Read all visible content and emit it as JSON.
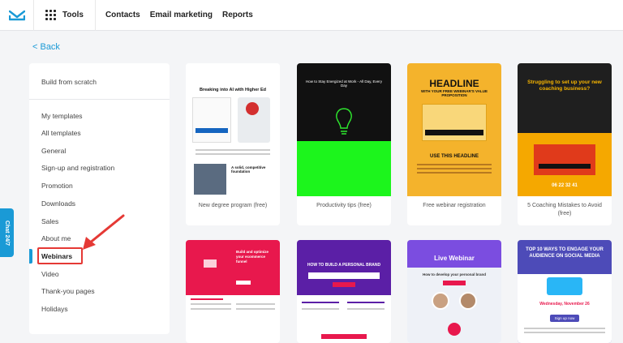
{
  "topbar": {
    "tools_label": "Tools",
    "nav": [
      "Contacts",
      "Email marketing",
      "Reports"
    ]
  },
  "back_label": "< Back",
  "sidebar": {
    "items": [
      "Build from scratch",
      "My templates",
      "All templates",
      "General",
      "Sign-up and registration",
      "Promotion",
      "Downloads",
      "Sales",
      "About me",
      "Webinars",
      "Video",
      "Thank-you pages",
      "Holidays"
    ],
    "active": "Webinars"
  },
  "chat_label": "Chat 24/7",
  "cards": [
    {
      "label": "New degree program (free)",
      "title": "Breaking into AI with Higher Ed",
      "sub": "A solid, competitive foundation"
    },
    {
      "label": "Productivity tips (free)",
      "title": "How to Stay Energized at Work - All Day, Every Day"
    },
    {
      "label": "Free webinar registration",
      "title": "HEADLINE",
      "sub": "WITH YOUR FREE WEBINAR'S VALUE PROPOSITION",
      "sub2": "USE THIS HEADLINE"
    },
    {
      "label": "5 Coaching Mistakes to Avoid (free)",
      "title": "Struggling to set up your new coaching business?",
      "countdown": "06  22  32  41"
    },
    {
      "label": "",
      "title": "Build and optimize your ecommerce funnel"
    },
    {
      "label": "",
      "title": "HOW TO BUILD A PERSONAL BRAND"
    },
    {
      "label": "",
      "title": "Live Webinar",
      "sub": "How to develop your personal brand"
    },
    {
      "label": "",
      "title": "TOP 10 WAYS TO ENGAGE YOUR AUDIENCE ON SOCIAL MEDIA",
      "sub": "Wednesday, November 26",
      "button": "Sign up now"
    }
  ],
  "colors": {
    "accent": "#1a9ad6",
    "highlight": "#e53935"
  }
}
